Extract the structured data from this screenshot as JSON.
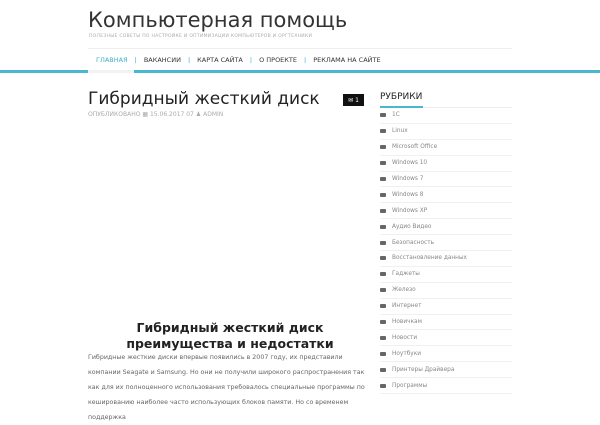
{
  "site": {
    "title": "Компьютерная помощь",
    "tagline": "Полезные советы по настройке и оптимизации компьютеров и оргтехники"
  },
  "nav": [
    "ГЛАВНАЯ",
    "ВАКАНСИИ",
    "КАРТА САЙТА",
    "О ПРОЕКТЕ",
    "РЕКЛАМА НА САЙТЕ"
  ],
  "post": {
    "title": "Гибридный жесткий диск",
    "meta_label": "ОПУБЛИКОВАНО",
    "date": "15.06.2017 07",
    "author": "ADMIN",
    "comments": "1",
    "section_title": "Гибридный жесткий диск преимущества и недостатки",
    "paragraph": "Гибридные жесткие диски впервые появились в 2007 году, их представили компании Seagate и Samsung. Но они не получили широкого распространения так как для их полноценного использования требовалось специальные программы по кешированию наиболее часто использующих блоков памяти. Но со временем поддержка"
  },
  "sidebar": {
    "heading": "РУБРИКИ",
    "categories": [
      "1С",
      "Linux",
      "Microsoft Office",
      "Windows 10",
      "Windows 7",
      "Windows 8",
      "Windows XP",
      "Аудио Видео",
      "Безопасность",
      "Восстановление данных",
      "Гаджеты",
      "Железо",
      "Интернет",
      "Новичкам",
      "Новости",
      "Ноутбуки",
      "Принтеры Драйвера",
      "Программы"
    ]
  },
  "colors": {
    "accent": "#49b8ce"
  }
}
